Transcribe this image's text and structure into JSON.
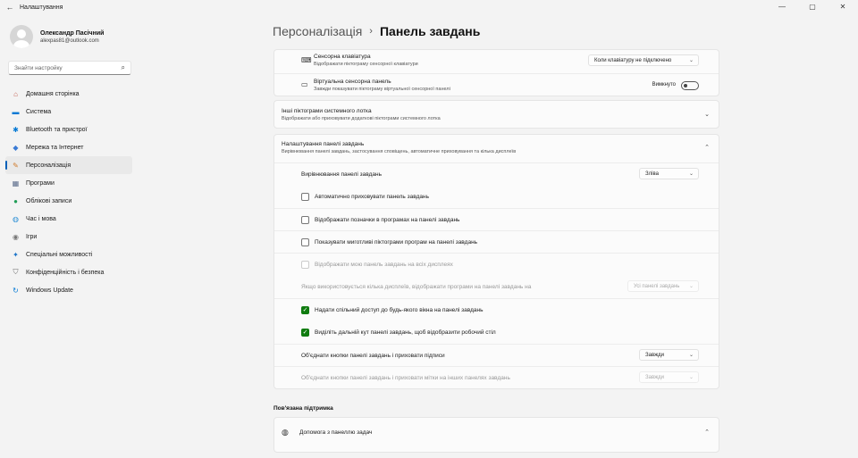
{
  "window": {
    "title": "Налаштування",
    "back": "←",
    "min": "—",
    "max": "▢",
    "close": "✕"
  },
  "profile": {
    "name": "Олександр Пасічний",
    "email": "alexpas81@outlook.com"
  },
  "search": {
    "placeholder": "Знайти настройку"
  },
  "nav": [
    {
      "label": "Домашня сторінка",
      "icon": "home-icon",
      "glyph": "⌂",
      "color": "#c0584a"
    },
    {
      "label": "Система",
      "icon": "monitor-icon",
      "glyph": "▬",
      "color": "#0078d4"
    },
    {
      "label": "Bluetooth та пристрої",
      "icon": "bluetooth-icon",
      "glyph": "✱",
      "color": "#0078d4"
    },
    {
      "label": "Мережа та Інтернет",
      "icon": "wifi-icon",
      "glyph": "◆",
      "color": "#3a7bd5"
    },
    {
      "label": "Персоналізація",
      "icon": "brush-icon",
      "glyph": "✎",
      "color": "#d07a2a"
    },
    {
      "label": "Програми",
      "icon": "apps-icon",
      "glyph": "▦",
      "color": "#5b6b8a"
    },
    {
      "label": "Облікові записи",
      "icon": "account-icon",
      "glyph": "●",
      "color": "#1f9d55"
    },
    {
      "label": "Час і мова",
      "icon": "globe-clock-icon",
      "glyph": "◍",
      "color": "#2a8fd5"
    },
    {
      "label": "Ігри",
      "icon": "gamepad-icon",
      "glyph": "◉",
      "color": "#777777"
    },
    {
      "label": "Спеціальні можливості",
      "icon": "accessibility-icon",
      "glyph": "✦",
      "color": "#1a73c8"
    },
    {
      "label": "Конфіденційність і безпека",
      "icon": "shield-icon",
      "glyph": "⛉",
      "color": "#6b6b6b"
    },
    {
      "label": "Windows Update",
      "icon": "update-icon",
      "glyph": "↻",
      "color": "#0078d4"
    }
  ],
  "breadcrumb": {
    "parent": "Персоналізація",
    "sep": "›",
    "current": "Панель завдань"
  },
  "touch_keyboard": {
    "label": "Сенсорна клавіатура",
    "desc": "Відображати піктограму сенсорної клавіатури",
    "value": "Коли клавіатуру не підключено"
  },
  "virtual_touchpad": {
    "label": "Віртуальна сенсорна панель",
    "desc": "Завжди показувати піктограму віртуальної сенсорної панелі",
    "toggle_label": "Вимкнуто"
  },
  "other_tray": {
    "label": "Інші піктограми системного лотка",
    "desc": "Відображати або приховувати додаткові піктограми системного лотка"
  },
  "behaviors": {
    "label": "Налаштування панелі завдань",
    "desc": "Вирівнювання панелі завдань, застосування сповіщень, автоматичне приховування та кілька дисплеїв",
    "alignment": {
      "label": "Вирівнювання панелі завдань",
      "value": "Зліва"
    },
    "auto_hide": "Автоматично приховувати панель завдань",
    "badges": "Відображати позначки в програмах на панелі завдань",
    "flashing": "Показувати миготливі піктограми програм на панелі завдань",
    "all_displays": "Відображати мою панель завдань на всіх дисплеях",
    "multi_display": {
      "label": "Якщо використовується кілька дисплеїв, відображати програми на панелі завдань на",
      "value": "Усі панелі завдань"
    },
    "share_window": "Надати спільний доступ до будь-якого вікна на панелі завдань",
    "far_corner": "Виділіть дальній кут панелі завдань, щоб відобразити робочий стіл",
    "combine": {
      "label": "Об'єднати кнопки панелі завдань і приховати підписи",
      "value": "Завжди"
    },
    "combine_other": {
      "label": "Об'єднати кнопки панелі завдань і приховати мітки на інших панелях завдань",
      "value": "Завжди"
    }
  },
  "related": {
    "title": "Пов'язана підтримка",
    "help": "Допомога з панеллю задач"
  },
  "colors": {
    "accent": "#005fb8",
    "check": "#107c10"
  }
}
